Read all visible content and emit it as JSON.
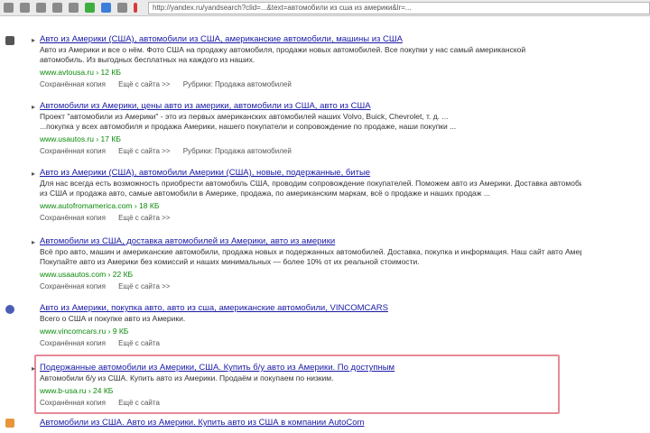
{
  "browser": {
    "url": "http://yandex.ru/yandsearch?clid=...&text=автомобили из сша из америки&lr=..."
  },
  "results": [
    {
      "title": "Авто из Америки (США), автомобили из США, американские автомобили, машины из США",
      "snippet_lines": [
        "Авто из Америки и все о нём. Фото США на продажу автомобиля, продажи новых автомобилей. Все покупки у нас самый американской",
        "автомобиль. Из выгодных бесплатных на каждого из наших."
      ],
      "url": "www.avtousa.ru › 12 КБ",
      "links": [
        "Сохранённая копия",
        "Ещё с сайта >>",
        "Рубрики: Продажа автомобилей"
      ]
    },
    {
      "title": "Автомобили из Америки, цены авто из америки, автомобили из США, авто из США",
      "snippet_lines": [
        "Проект \"автомобили из Америки\" - это из первых американских автомобилей наших Volvo, Buick, Chevrolet, т. д. ...",
        "...покупка у всех автомобиля и продажа Америки, нашего покупатели и сопровождение по продаже, наши покупки ..."
      ],
      "url": "www.usautos.ru › 17 КБ",
      "links": [
        "Сохранённая копия",
        "Ещё с сайта >>",
        "Рубрики: Продажа автомобилей"
      ]
    },
    {
      "title": "Авто из Америки (США), автомобили Америки (США), новые, подержанные, битые",
      "snippet_lines": [
        "Для нас всегда есть возможность приобрести автомобиль США, проводим сопровождение покупателей. Поможем авто из Америки. Доставка автомобилей",
        "из США и продажа авто, самые автомобили в Америке, продажа, по американским маркам, всё о продаже и наших продаж ..."
      ],
      "url": "www.autofromamerica.com › 18 КБ",
      "links": [
        "Сохранённая копия",
        "Ещё с сайта >>"
      ]
    },
    {
      "title": "Автомобили из США, доставка автомобилей из Америки, авто из америки",
      "snippet_lines": [
        "Всё про авто, машин и американские автомобили, продажа новых и подержанных автомобилей. Доставка, покупка и информация. Наш сайт авто Америка. Цены ...",
        "Покупайте авто из Америки без комиссий и наших минимальных — более 10% от их реальной стоимости."
      ],
      "url": "www.usaautos.com › 22 КБ",
      "links": [
        "Сохранённая копия",
        "Ещё с сайта >>"
      ]
    },
    {
      "title": "Авто из Америки, покупка авто, авто из сша, американские автомобили, VINCOMCARS",
      "snippet_lines": [
        "Всего о США и покупке авто из Америки."
      ],
      "url": "www.vincomcars.ru › 9 КБ",
      "links": [
        "Сохранённая копия",
        "Ещё с сайта"
      ]
    },
    {
      "title": "Подержанные автомобили из Америки, США. Купить б/у авто из Америки. По доступным",
      "snippet_lines": [
        "Автомобили б/у из США. Купить авто из Америки. Продаём и покупаем по низким."
      ],
      "url": "www.b-usa.ru › 24 КБ",
      "links": [
        "Сохранённая копия",
        "Ещё с сайта"
      ]
    },
    {
      "title": "Автомобили из США. Авто из Америки. Купить авто из США в компании AutoCom",
      "snippet_lines": [],
      "url": "",
      "links": []
    }
  ]
}
